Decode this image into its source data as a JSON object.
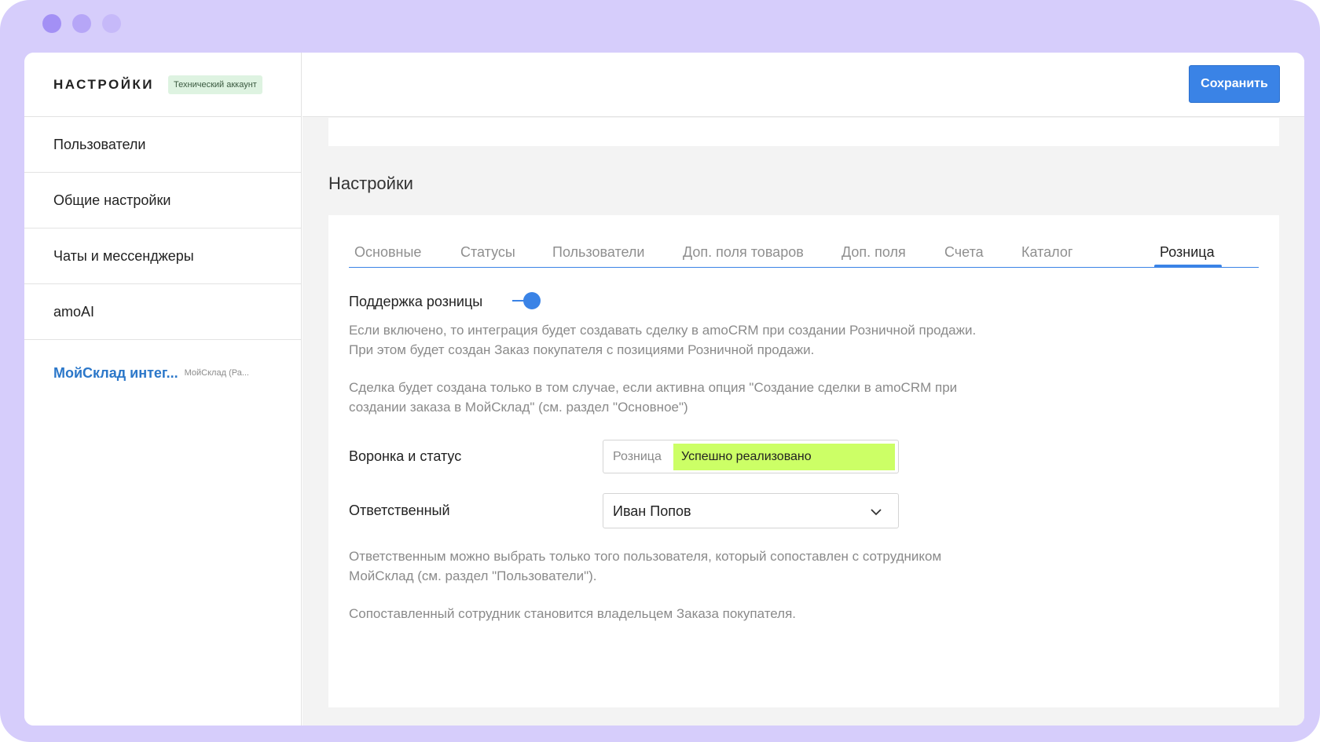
{
  "app": {
    "title": "НАСТРОЙКИ",
    "account_badge": "Технический аккаунт"
  },
  "sidebar": {
    "items": [
      {
        "label": "Пользователи"
      },
      {
        "label": "Общие настройки"
      },
      {
        "label": "Чаты и мессенджеры"
      },
      {
        "label": "amoAI"
      }
    ],
    "active_item": {
      "label": "МойСклад интег...",
      "sublabel": "МойСклад (Ра..."
    }
  },
  "toolbar": {
    "save_label": "Сохранить"
  },
  "main": {
    "section_title": "Настройки",
    "tabs": [
      {
        "label": "Основные"
      },
      {
        "label": "Статусы"
      },
      {
        "label": "Пользователи"
      },
      {
        "label": "Доп. поля товаров"
      },
      {
        "label": "Доп. поля"
      },
      {
        "label": "Счета"
      },
      {
        "label": "Каталог"
      },
      {
        "label": "Розница"
      }
    ],
    "active_tab": "Розница",
    "retail_support": {
      "label": "Поддержка розницы",
      "enabled": true,
      "desc_line1": "Если включено, то интеграция будет создавать сделку в amoCRM при создании Розничной продажи.",
      "desc_line2": "При этом будет создан Заказ покупателя с позициями Розничной продажи.",
      "desc_line3": "Сделка будет создана только в том случае, если активна опция \"Создание сделки в amoCRM при",
      "desc_line4": "создании заказа в МойСклад\" (см. раздел \"Основное\")"
    },
    "funnel": {
      "label": "Воронка и статус",
      "pipeline": "Розница",
      "status": "Успешно реализовано",
      "status_color": "#ccff66"
    },
    "responsible": {
      "label": "Ответственный",
      "value": "Иван Попов",
      "note_line1": "Ответственным можно выбрать только того пользователя, который сопоставлен с сотрудником",
      "note_line2": "МойСклад (см. раздел \"Пользователи\").",
      "note_line3": "Сопоставленный сотрудник становится владельцем Заказа покупателя."
    }
  },
  "colors": {
    "accent": "#3a83e6",
    "frame": "#d6cdfb",
    "badge_bg": "#def3e1",
    "active_link": "#2b77c9"
  }
}
